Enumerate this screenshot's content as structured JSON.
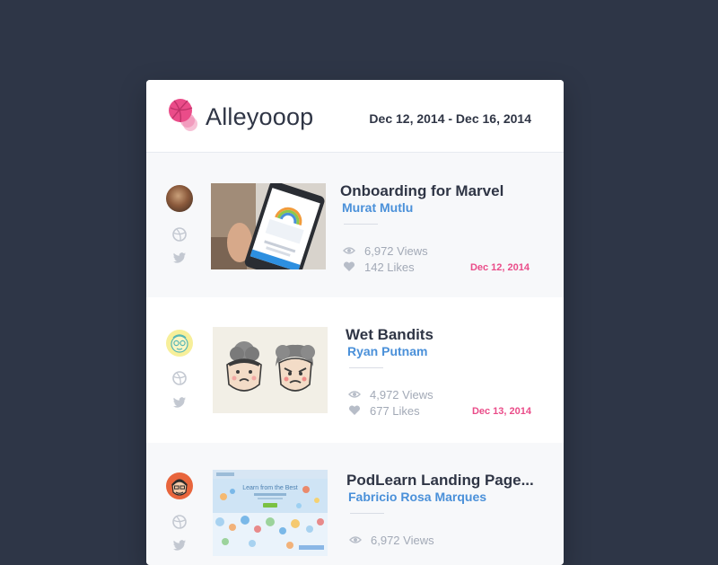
{
  "header": {
    "brand": "Alleyooop",
    "date_range": "Dec 12, 2014 - Dec 16, 2014"
  },
  "icons": {
    "logo": "dribbble-ball-logo",
    "dribbble": "dribbble-icon",
    "twitter": "twitter-icon",
    "views": "eye-icon",
    "likes": "heart-icon"
  },
  "colors": {
    "background": "#2e3647",
    "accent_pink": "#ea4c89",
    "author_blue": "#4a90d9",
    "text_dark": "#2f3545",
    "text_muted": "#a2a9b6"
  },
  "shots": [
    {
      "title": "Onboarding for Marvel",
      "author": "Murat Mutlu",
      "views": "6,972 Views",
      "likes": "142 Likes",
      "date": "Dec 12, 2014"
    },
    {
      "title": "Wet Bandits",
      "author": "Ryan Putnam",
      "views": "4,972 Views",
      "likes": "677 Likes",
      "date": "Dec 13, 2014"
    },
    {
      "title": "PodLearn Landing Page...",
      "author": "Fabricio Rosa Marques",
      "views": "6,972 Views",
      "likes": "",
      "date": ""
    }
  ],
  "thumbnails": {
    "podlearn_heading": "Learn from the Best"
  }
}
